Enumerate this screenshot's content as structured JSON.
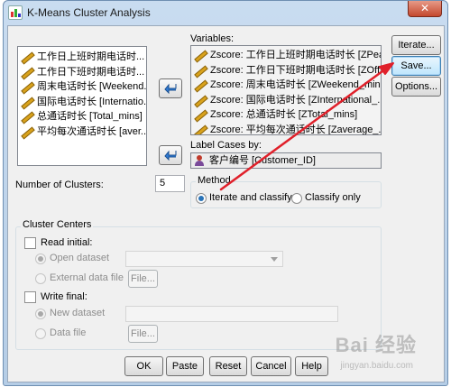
{
  "window": {
    "title": "K-Means Cluster Analysis",
    "close_glyph": "✕"
  },
  "source_list": {
    "items": [
      "工作日上班时期电话时...",
      "工作日下班时期电话时...",
      "周末电话时长 [Weekend...",
      "国际电话时长 [Internatio...",
      "总通话时长 [Total_mins]",
      "平均每次通话时长 [aver..."
    ]
  },
  "variables": {
    "label": "Variables:",
    "items": [
      "Zscore: 工作日上班时期电话时长 [ZPea...",
      "Zscore: 工作日下班时期电话时长 [ZOffP...",
      "Zscore: 周末电话时长 [ZWeekend_mins]",
      "Zscore: 国际电话时长 [ZInternational_...",
      "Zscore: 总通话时长 [ZTotal_mins]",
      "Zscore: 平均每次通话时长 [Zaverage_..."
    ]
  },
  "label_cases": {
    "label": "Label Cases by:",
    "value": "客户编号 [Customer_ID]"
  },
  "side_buttons": {
    "iterate": "Iterate...",
    "save": "Save...",
    "options": "Options..."
  },
  "clusters": {
    "label": "Number of Clusters:",
    "value": "5"
  },
  "method": {
    "title": "Method",
    "iterate": "Iterate and classify",
    "classify": "Classify only",
    "selected": "iterate"
  },
  "cluster_centers": {
    "title": "Cluster Centers",
    "read_initial": "Read initial:",
    "open_dataset": "Open dataset",
    "external_file": "External data file",
    "file_button": "File...",
    "write_final": "Write final:",
    "new_dataset": "New dataset",
    "data_file": "Data file"
  },
  "bottom_buttons": {
    "ok": "OK",
    "paste": "Paste",
    "reset": "Reset",
    "cancel": "Cancel",
    "help": "Help"
  },
  "watermark": {
    "text": "Bai 经验",
    "sub": "jingyan.baidu.com"
  },
  "colors": {
    "annotation_arrow": "#e0202a",
    "selection": "#2a74b8"
  }
}
